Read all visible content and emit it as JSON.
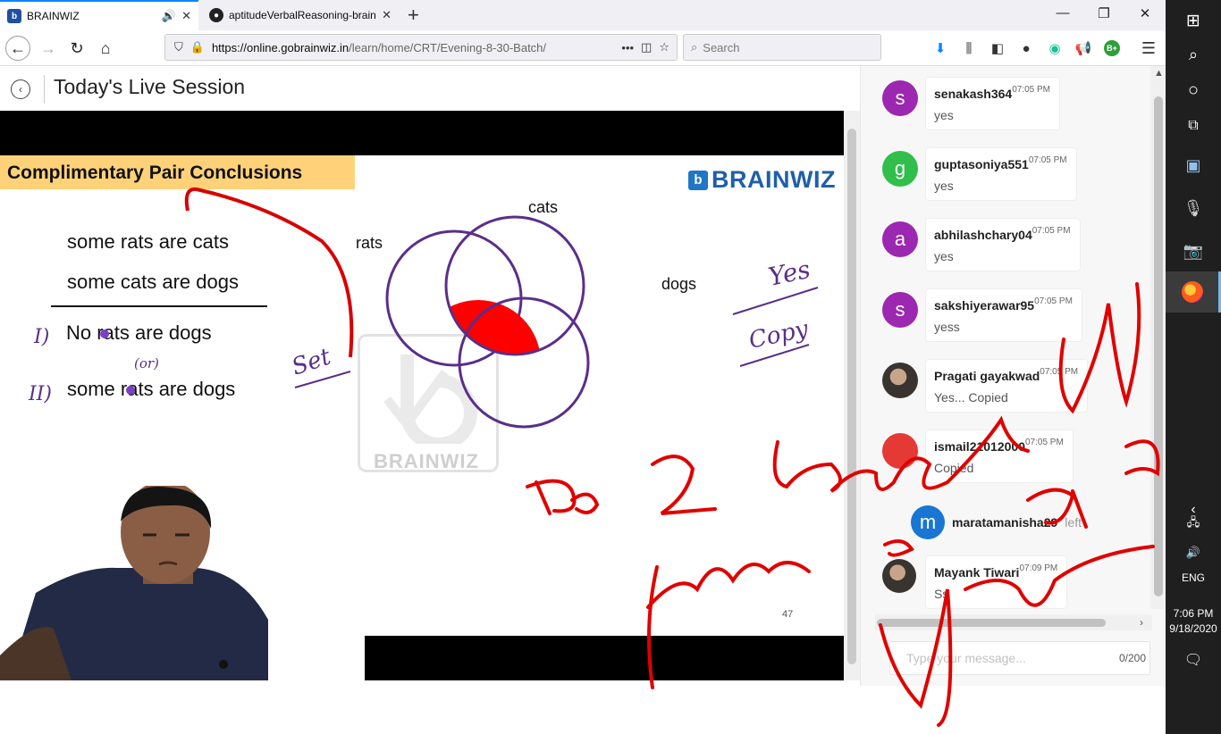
{
  "browser": {
    "tabs": [
      {
        "title": "BRAINWIZ",
        "active": true
      },
      {
        "title": "aptitudeVerbalReasoning-brain",
        "active": false
      }
    ],
    "url_host": "https://online.gobrainwiz.in",
    "url_path": "/learn/home/CRT/Evening-8-30-Batch/",
    "search_placeholder": "Search",
    "toolbar_icons": [
      "download-icon",
      "library-icon",
      "sidebar-icon",
      "account-icon",
      "grammarly-icon",
      "megaphone-icon",
      "extension-icon",
      "menu-icon"
    ],
    "extension_badge": "B+"
  },
  "page": {
    "title": "Today's Live Session"
  },
  "slide": {
    "heading": "Complimentary Pair Conclusions",
    "premise1": "some rats are cats",
    "premise2": "some cats are dogs",
    "conclusion1": "No rats are dogs",
    "conclusion2": "some rats are dogs",
    "label_cats": "cats",
    "label_rats": "rats",
    "label_dogs": "dogs",
    "brand": "BRAINWIZ",
    "brand_mark": "b",
    "watermark": "BRAINWIZ",
    "page_number": "47",
    "colors": {
      "heading_bg": "#ffd27a",
      "venn_stroke": "#5a2e8a",
      "highlight": "#ff0000",
      "brand": "#1f5fa8"
    }
  },
  "chat": {
    "messages": [
      {
        "initial": "s",
        "avatar_color": "#9c27b0",
        "user": "senakash364",
        "time": "07:05 PM",
        "text": "yes"
      },
      {
        "initial": "g",
        "avatar_color": "#2fbf4a",
        "user": "guptasoniya551",
        "time": "07:05 PM",
        "text": "yes"
      },
      {
        "initial": "a",
        "avatar_color": "#9c27b0",
        "user": "abhilashchary04",
        "time": "07:05 PM",
        "text": "yes"
      },
      {
        "initial": "s",
        "avatar_color": "#9c27b0",
        "user": "sakshiyerawar95",
        "time": "07:05 PM",
        "text": "yess"
      },
      {
        "initial": "",
        "avatar_color": "photo",
        "user": "Pragati gayakwad",
        "time": "07:05 PM",
        "text": "Yes... Copied"
      },
      {
        "initial": "",
        "avatar_color": "#e53935",
        "user": "ismail21012000",
        "time": "07:05 PM",
        "text": "Copied"
      },
      {
        "initial": "",
        "avatar_color": "photo",
        "user": "Mayank Tiwari",
        "time": "07:09 PM",
        "text": "Ss"
      }
    ],
    "left_notice": {
      "initial": "m",
      "user": "maratamanisha29",
      "text": "left"
    },
    "input_placeholder": "Type your message...",
    "char_count": "0/200"
  },
  "annotations_text": {
    "set": "Set",
    "or_note": "(or)",
    "yes": "Yes",
    "copy": "Copy"
  },
  "taskbar": {
    "language": "ENG",
    "time": "7:06 PM",
    "date": "9/18/2020",
    "icons": [
      "windows-start-icon",
      "search-icon",
      "cortana-icon",
      "task-view-icon",
      "photos-app-icon",
      "microphone-app-icon",
      "camera-app-icon",
      "firefox-icon"
    ]
  }
}
